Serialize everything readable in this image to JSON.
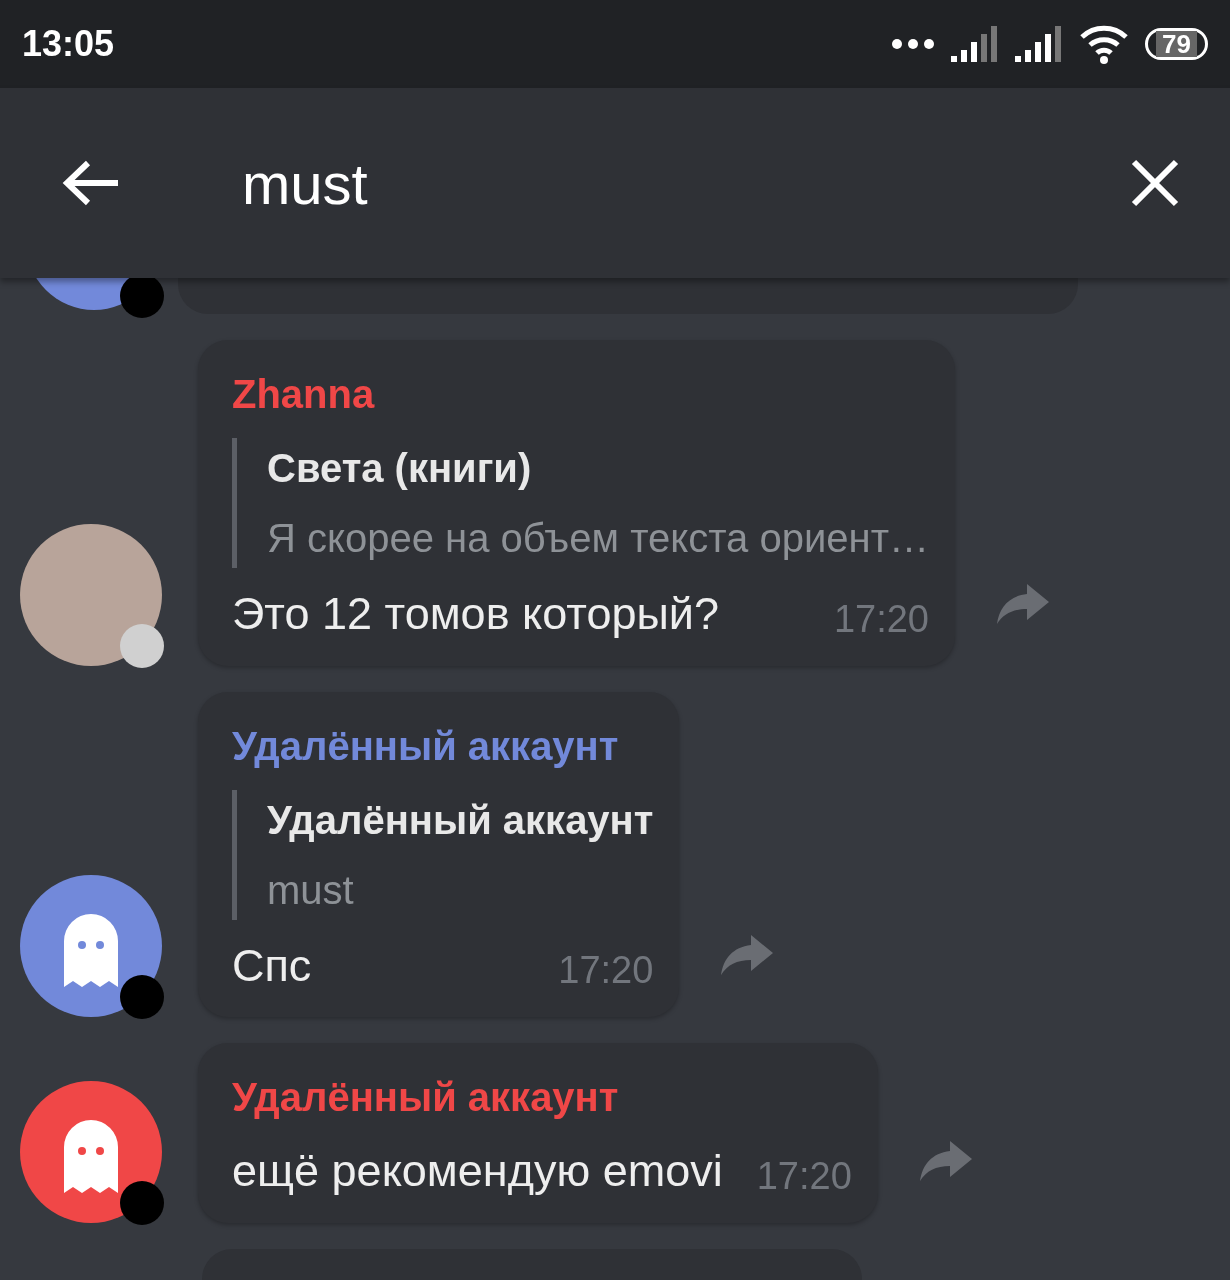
{
  "status_bar": {
    "time": "13:05",
    "battery": "79"
  },
  "search": {
    "value": "must"
  },
  "messages": [
    {
      "author": "Zhanna",
      "color": "#f04747",
      "avatar": {
        "kind": "photo",
        "status": {
          "color": "#d0d0d0"
        }
      },
      "reply": {
        "author": "Света (книги)",
        "text": "Я скорее на объем текста ориент…"
      },
      "text": "Это 12 томов который?",
      "time": "17:20"
    },
    {
      "author": "Удалённый аккаунт",
      "color": "#7289da",
      "avatar": {
        "kind": "ghost",
        "color": "#7289da",
        "status": {
          "color": "#000000"
        }
      },
      "reply": {
        "author": "Удалённый аккаунт",
        "text": "must"
      },
      "text": "Спс",
      "time": "17:20"
    },
    {
      "author": "Удалённый аккаунт",
      "color": "#f04747",
      "avatar": {
        "kind": "ghost",
        "color": "#f04747",
        "status": {
          "color": "#000000"
        }
      },
      "text": "ещё рекомендую emovi",
      "time": "17:20"
    }
  ]
}
